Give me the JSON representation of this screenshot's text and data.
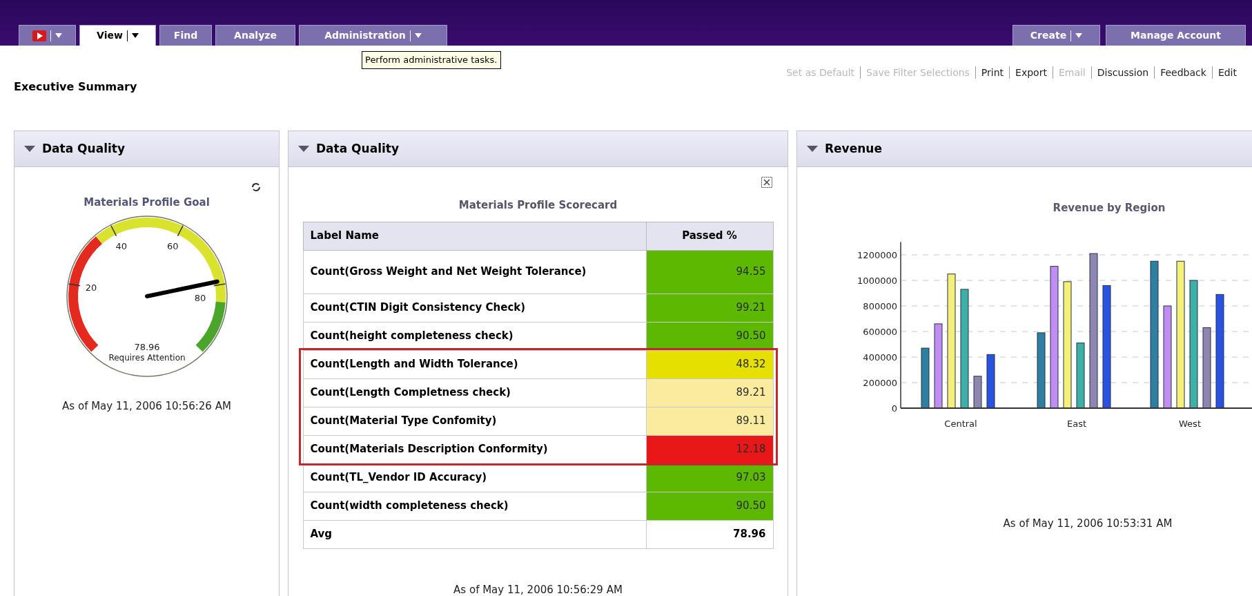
{
  "nav": {
    "tabs": [
      {
        "kind": "logo",
        "selected": false,
        "dropdown": true
      },
      {
        "kind": "text",
        "label": "View",
        "selected": true,
        "dropdown": true
      },
      {
        "kind": "text",
        "label": "Find",
        "selected": false,
        "dropdown": false
      },
      {
        "kind": "text",
        "label": "Analyze",
        "selected": false,
        "dropdown": false
      },
      {
        "kind": "text",
        "label": "Administration",
        "selected": false,
        "dropdown": true
      }
    ],
    "right_tabs": [
      {
        "label": "Create",
        "dropdown": true
      },
      {
        "label": "Manage Account",
        "dropdown": false
      }
    ],
    "tooltip": "Perform administrative tasks."
  },
  "actions": [
    {
      "label": "Set as Default",
      "disabled": true
    },
    {
      "label": "Save Filter Selections",
      "disabled": true
    },
    {
      "label": "Print",
      "disabled": false
    },
    {
      "label": "Export",
      "disabled": false
    },
    {
      "label": "Email",
      "disabled": true
    },
    {
      "label": "Discussion",
      "disabled": false
    },
    {
      "label": "Feedback",
      "disabled": false
    },
    {
      "label": "Edit",
      "disabled": false
    }
  ],
  "page_title": "Executive Summary",
  "gauge_panel": {
    "title": "Data Quality",
    "chart_title": "Materials Profile Goal",
    "gauge": {
      "ticks": [
        "20",
        "40",
        "60",
        "80"
      ],
      "value": "78.96",
      "status": "Requires Attention"
    },
    "timestamp": "As of May 11, 2006 10:56:26 AM"
  },
  "scorecard_panel": {
    "title": "Data Quality",
    "table_title": "Materials Profile Scorecard",
    "columns": [
      "Label Name",
      "Passed %"
    ],
    "rows": [
      {
        "kind": "metric",
        "label": "Count(Gross Weight and Net Weight Tolerance)",
        "value": "94.55",
        "color": "#5cb800",
        "highlighted": false
      },
      {
        "kind": "metric",
        "label": "Count(CTIN Digit Consistency Check)",
        "value": "99.21",
        "color": "#5cb800",
        "highlighted": false
      },
      {
        "kind": "metric",
        "label": "Count(height completeness check)",
        "value": "90.50",
        "color": "#5cb800",
        "highlighted": false
      },
      {
        "kind": "metric",
        "label": "Count(Length and Width Tolerance)",
        "value": "48.32",
        "color": "#e6e000",
        "highlighted": true
      },
      {
        "kind": "metric",
        "label": "Count(Length Completness check)",
        "value": "89.21",
        "color": "#fbeb9e",
        "highlighted": true
      },
      {
        "kind": "metric",
        "label": "Count(Material Type Confomity)",
        "value": "89.11",
        "color": "#fbeb9e",
        "highlighted": true
      },
      {
        "kind": "metric",
        "label": "Count(Materials Description Conformity)",
        "value": "12.18",
        "color": "#e81818",
        "highlighted": true
      },
      {
        "kind": "metric",
        "label": "Count(TL_Vendor ID Accuracy)",
        "value": "97.03",
        "color": "#5cb800",
        "highlighted": false
      },
      {
        "kind": "metric",
        "label": "Count(width completeness check)",
        "value": "90.50",
        "color": "#5cb800",
        "highlighted": false
      },
      {
        "kind": "total",
        "label": "Avg",
        "value": "78.96",
        "highlighted": false
      }
    ],
    "timestamp": "As of May 11, 2006 10:56:29 AM"
  },
  "revenue_panel": {
    "title": "Revenue",
    "chart_data": {
      "type": "bar",
      "title": "Revenue by Region",
      "categories": [
        "Central",
        "East",
        "West"
      ],
      "ylim": [
        0,
        1300000
      ],
      "grid": true,
      "yticks": [
        0,
        200000,
        400000,
        600000,
        800000,
        1000000,
        1200000
      ],
      "series": [
        {
          "color": "#2f7fa3",
          "values": [
            470000,
            590000,
            1150000
          ]
        },
        {
          "color": "#c08ef0",
          "values": [
            660000,
            1110000,
            800000
          ]
        },
        {
          "color": "#f5f07a",
          "values": [
            1050000,
            990000,
            1150000
          ]
        },
        {
          "color": "#3fb0a6",
          "values": [
            930000,
            510000,
            1000000
          ]
        },
        {
          "color": "#8e86b0",
          "values": [
            250000,
            1210000,
            630000
          ]
        },
        {
          "color": "#2a52e0",
          "values": [
            420000,
            960000,
            890000
          ]
        }
      ]
    },
    "timestamp": "As of May 11, 2006 10:53:31 AM"
  }
}
